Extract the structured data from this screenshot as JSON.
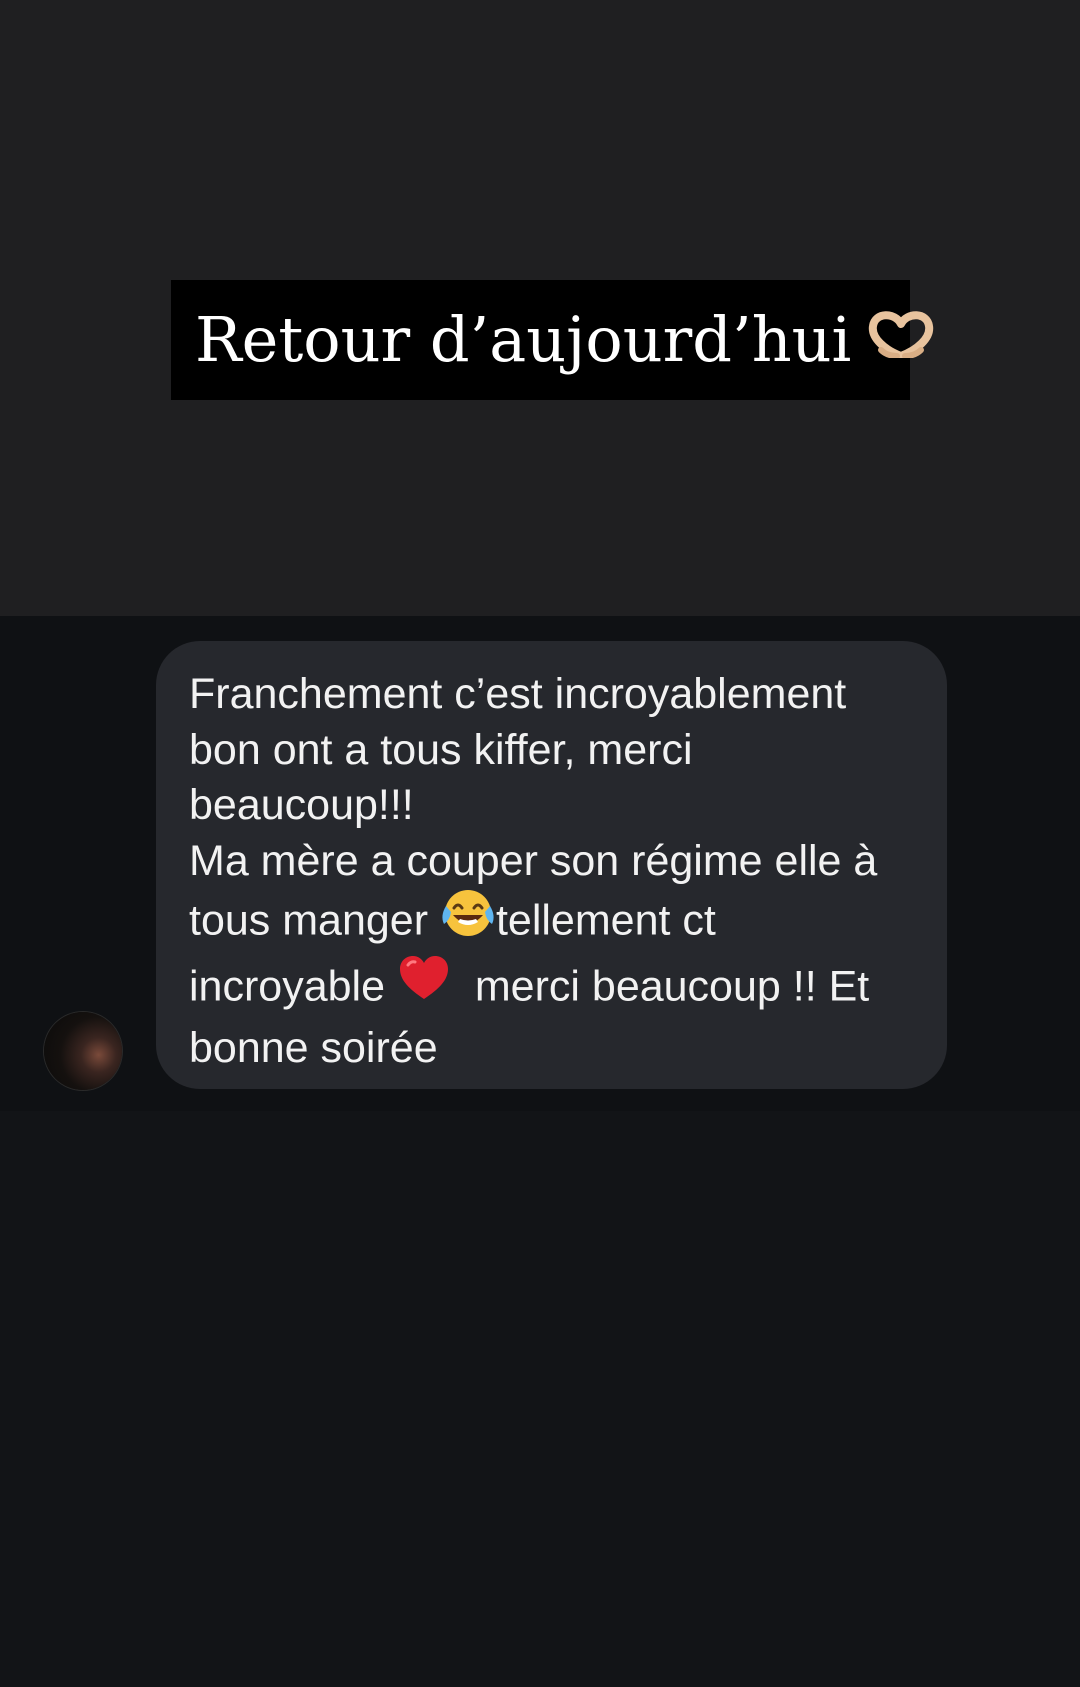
{
  "story": {
    "title": "Retour d’aujourd’hui",
    "title_icon": "heart-hands-icon"
  },
  "message": {
    "lines": [
      {
        "text": "Franchement c’est incroyablement"
      },
      {
        "text": "bon ont a tous kiffer, merci"
      },
      {
        "text": "beaucoup!!!"
      },
      {
        "text": "Ma mère a couper son régime elle à"
      },
      {
        "before": "tous manger ",
        "icon": "laughing-tears-emoji",
        "after": "tellement ct"
      },
      {
        "before": "incroyable ",
        "icon": "red-heart-emoji",
        "after": "  merci beaucoup !! Et"
      },
      {
        "text": "bonne soirée"
      }
    ]
  },
  "colors": {
    "top_background": "#1f1f21",
    "strip_background": "#0f1114",
    "bubble_background": "#26282d",
    "text": "#f2f2f2",
    "title_box": "#000000"
  }
}
